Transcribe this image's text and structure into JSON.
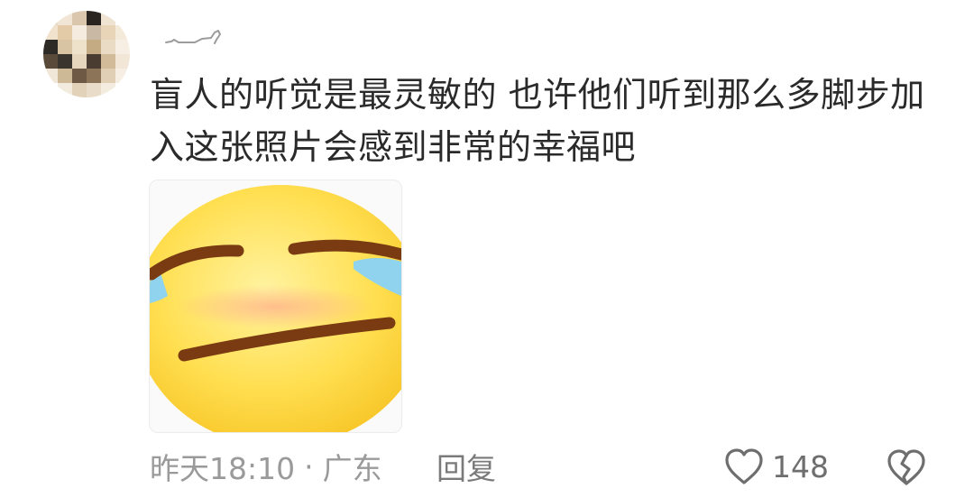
{
  "comment": {
    "text": "盲人的听觉是最灵敏的 也许他们听到那么多脚步加入这张照片会感到非常的幸福吧"
  },
  "meta": {
    "time": "昨天18:10",
    "separator": "·",
    "location": "广东"
  },
  "actions": {
    "reply_label": "回复",
    "like_count": "148",
    "like_icon": "heart-outline-icon",
    "dislike_icon": "broken-heart-icon"
  },
  "sticker": {
    "icon": "crying-laughing-emoji"
  },
  "colors": {
    "text": "#2a2a2a",
    "meta": "#9a9a9a",
    "icon": "#6e6e6e",
    "emoji_yellow": "#ffd84a",
    "emoji_tears": "#8fd3ee"
  }
}
